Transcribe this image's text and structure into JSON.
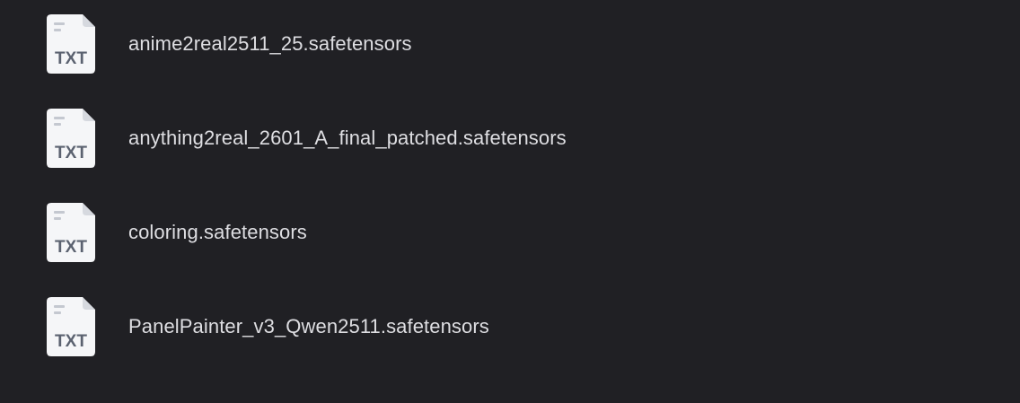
{
  "colors": {
    "background": "#202024",
    "file_name_text": "#dedee2",
    "icon_page": "#f5f6f8",
    "icon_fold": "#d6d9df",
    "icon_label": "#5b6270",
    "icon_lines": "#c4c8d0"
  },
  "files": [
    {
      "name": "anime2real2511_25.safetensors",
      "icon": "txt-file-icon",
      "icon_label": "TXT"
    },
    {
      "name": "anything2real_2601_A_final_patched.safetensors",
      "icon": "txt-file-icon",
      "icon_label": "TXT"
    },
    {
      "name": "coloring.safetensors",
      "icon": "txt-file-icon",
      "icon_label": "TXT"
    },
    {
      "name": "PanelPainter_v3_Qwen2511.safetensors",
      "icon": "txt-file-icon",
      "icon_label": "TXT"
    }
  ]
}
